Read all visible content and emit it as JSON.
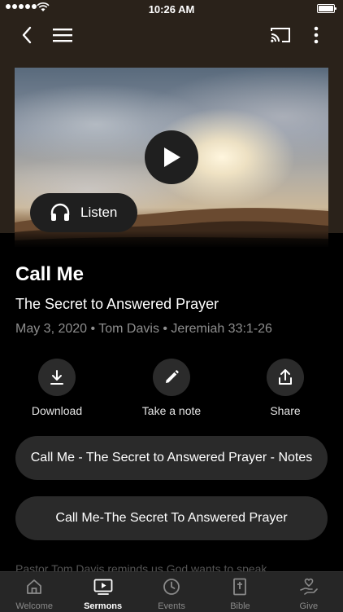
{
  "status_bar": {
    "time": "10:26 AM"
  },
  "header": {
    "icons": [
      "back-arrow-icon",
      "hamburger-menu-icon",
      "cast-icon",
      "more-vertical-icon"
    ]
  },
  "player": {
    "listen_label": "Listen"
  },
  "sermon": {
    "title": "Call Me",
    "subtitle": "The Secret to Answered Prayer",
    "meta": "May 3, 2020 • Tom Davis • Jeremiah 33:1-26"
  },
  "actions": [
    {
      "label": "Download",
      "icon": "download-icon"
    },
    {
      "label": "Take a note",
      "icon": "pencil-icon"
    },
    {
      "label": "Share",
      "icon": "share-icon"
    }
  ],
  "resources": [
    {
      "label": "Call Me - The Secret to Answered Prayer - Notes"
    },
    {
      "label": "Call Me-The Secret To Answered Prayer"
    }
  ],
  "description_peek": "Pastor Tom Davis reminds us God wants to speak",
  "tabs": [
    {
      "label": "Welcome",
      "icon": "home-icon",
      "active": false
    },
    {
      "label": "Sermons",
      "icon": "video-play-icon",
      "active": true
    },
    {
      "label": "Events",
      "icon": "clock-icon",
      "active": false
    },
    {
      "label": "Bible",
      "icon": "bible-icon",
      "active": false
    },
    {
      "label": "Give",
      "icon": "giving-hand-icon",
      "active": false
    }
  ],
  "colors": {
    "background": "#000000",
    "header_bg": "#2a221a",
    "button_bg": "#2a2a2a",
    "tabbar_bg": "#262626",
    "muted_text": "#8e8e8e"
  }
}
